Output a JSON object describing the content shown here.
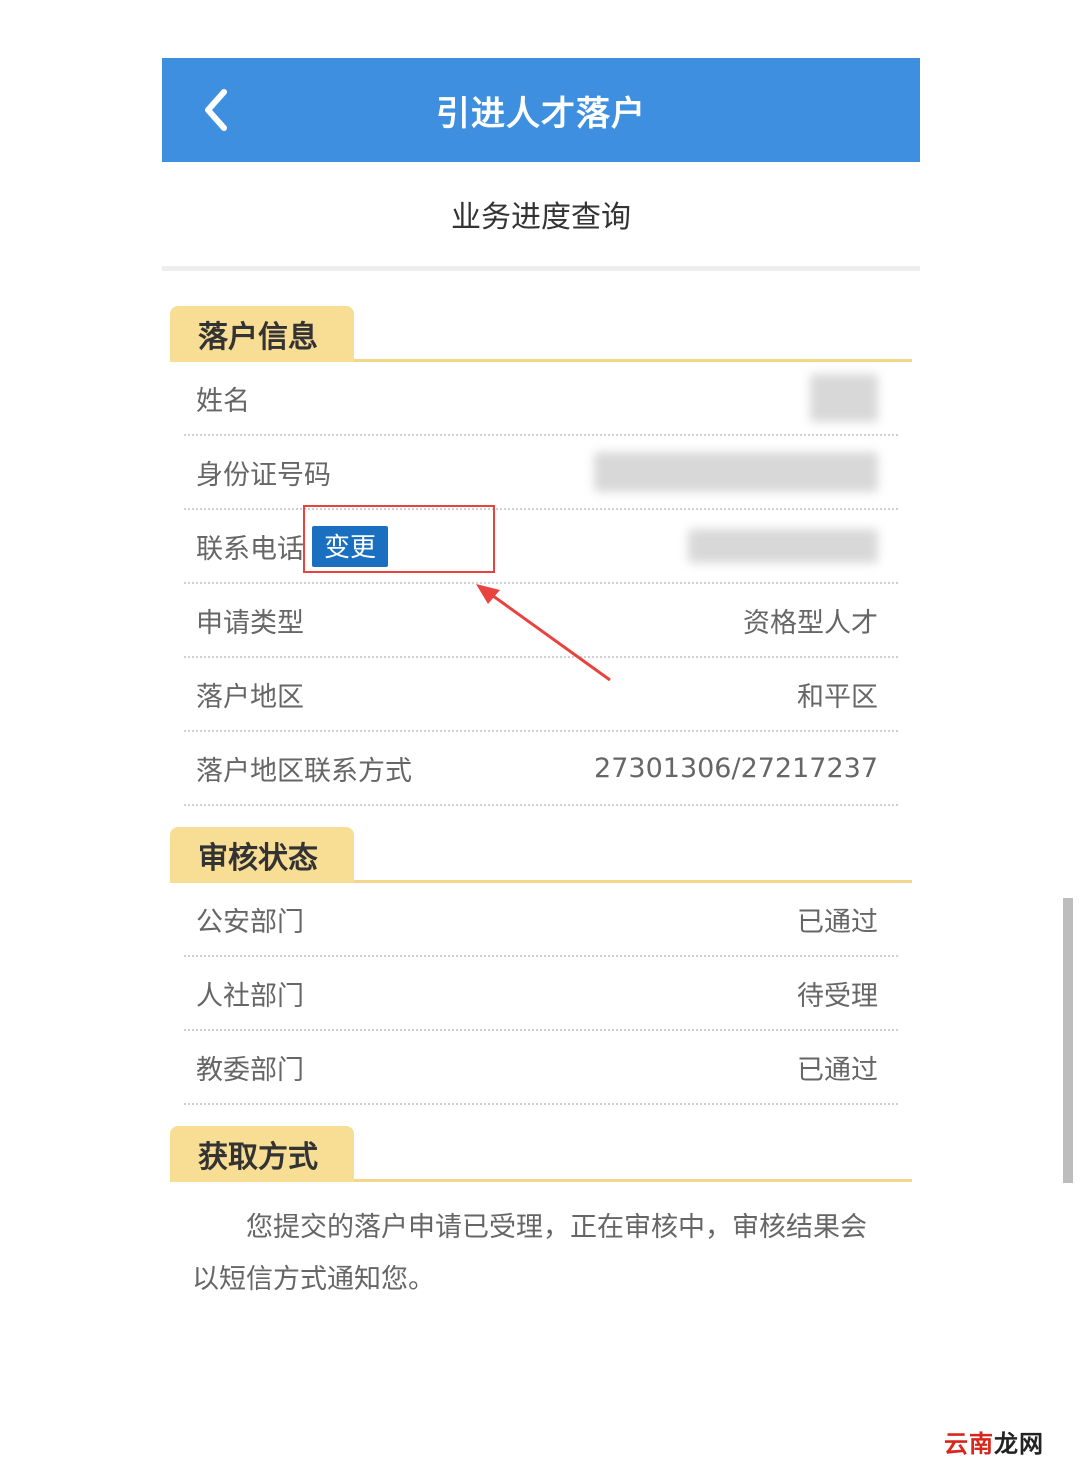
{
  "header": {
    "title": "引进人才落户",
    "back_icon": "chevron-left-icon"
  },
  "subtitle": "业务进度查询",
  "sections": {
    "settle_info": {
      "title": "落户信息",
      "rows": [
        {
          "label": "姓名",
          "value": ""
        },
        {
          "label": "身份证号码",
          "value": ""
        },
        {
          "label": "联系电话",
          "value": "",
          "action": "变更"
        },
        {
          "label": "申请类型",
          "value": "资格型人才"
        },
        {
          "label": "落户地区",
          "value": "和平区"
        },
        {
          "label": "落户地区联系方式",
          "value": "27301306/27217237"
        }
      ]
    },
    "review_status": {
      "title": "审核状态",
      "rows": [
        {
          "label": "公安部门",
          "value": "已通过"
        },
        {
          "label": "人社部门",
          "value": "待受理"
        },
        {
          "label": "教委部门",
          "value": "已通过"
        }
      ]
    },
    "obtain_method": {
      "title": "获取方式",
      "text": "您提交的落户申请已受理，正在审核中，审核结果会以短信方式通知您。"
    }
  },
  "watermark": {
    "part1": "云南",
    "part2": "龙网"
  },
  "colors": {
    "header": "#3f8fe0",
    "tab": "#f8dd94",
    "button": "#1a6fc0",
    "annotation": "#e8433f"
  }
}
